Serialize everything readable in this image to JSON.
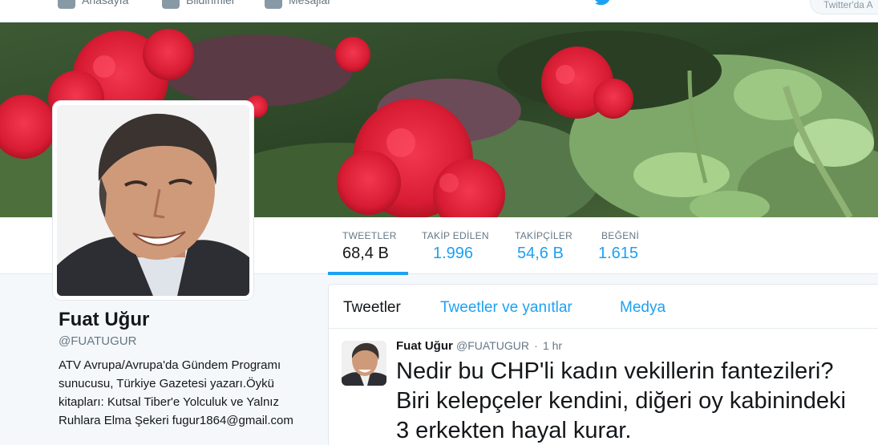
{
  "nav": {
    "home_label": "Anasayfa",
    "notifications_label": "Bildirimler",
    "messages_label": "Mesajlar",
    "search_placeholder": "Twitter'da A"
  },
  "profile": {
    "name": "Fuat Uğur",
    "handle": "@FUATUGUR",
    "bio": "ATV Avrupa/Avrupa'da Gündem Programı sunucusu, Türkiye Gazetesi yazarı.Öykü kitapları: Kutsal Tiber'e Yolculuk ve Yalnız Ruhlara Elma Şekeri fugur1864@gmail.com"
  },
  "stats": [
    {
      "label": "TWEETLER",
      "value": "68,4 B"
    },
    {
      "label": "TAKİP EDİLEN",
      "value": "1.996"
    },
    {
      "label": "TAKİPÇİLER",
      "value": "54,6 B"
    },
    {
      "label": "BEĞENİ",
      "value": "1.615"
    }
  ],
  "tabs": [
    {
      "label": "Tweetler"
    },
    {
      "label": "Tweetler ve yanıtlar"
    },
    {
      "label": "Medya"
    }
  ],
  "tweet": {
    "name": "Fuat Uğur",
    "handle": "@FUATUGUR",
    "separator": "·",
    "time": "1 hr",
    "text": "Nedir bu CHP'li kadın vekillerin fantezileri? Biri kelepçeler kendini, diğeri oy kabinindeki 3 erkekten hayal kurar."
  },
  "colors": {
    "accent": "#1da1f2",
    "text": "#14171a",
    "muted": "#657786",
    "background": "#f5f8fa"
  }
}
